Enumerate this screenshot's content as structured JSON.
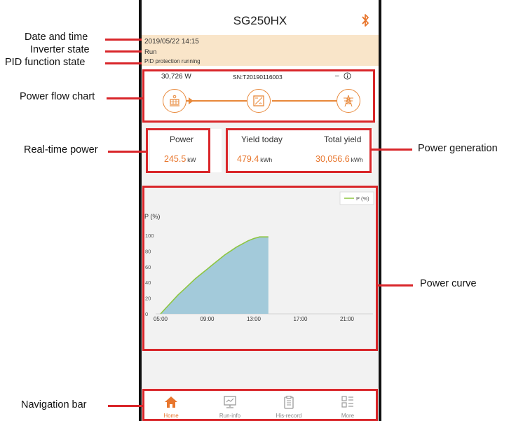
{
  "app": {
    "title": "SG250HX",
    "bluetooth_icon": "bluetooth-icon"
  },
  "status": {
    "datetime": "2019/05/22 14:15",
    "inverter_state": "Run",
    "pid_state": "PID protection running"
  },
  "flow": {
    "power": "30,726 W",
    "serial": "SN:T20190116003",
    "grid_value": "–",
    "nodes": [
      "pv-panel-icon",
      "inverter-icon",
      "grid-tower-icon"
    ],
    "accent": "#e8883a"
  },
  "realtime": {
    "title": "Power",
    "value": "245.5",
    "unit": "kW"
  },
  "generation": {
    "today_title": "Yield today",
    "today_value": "479.4",
    "today_unit": "kWh",
    "total_title": "Total yield",
    "total_value": "30,056.6",
    "total_unit": "kWh"
  },
  "chart_data": {
    "type": "area",
    "ylabel": "P (%)",
    "legend": [
      "P (%)"
    ],
    "legend_position": "top-right",
    "ylim": [
      0,
      100
    ],
    "yticks": [
      "0",
      "20",
      "40",
      "60",
      "80",
      "100"
    ],
    "xticks": [
      "05:00",
      "09:00",
      "13:00",
      "17:00",
      "21:00"
    ],
    "series": [
      {
        "name": "P (%)",
        "x": [
          "05:00",
          "05:30",
          "06:00",
          "06:30",
          "07:00",
          "07:30",
          "08:00",
          "08:30",
          "09:00",
          "09:30",
          "10:00",
          "10:30",
          "11:00",
          "11:30",
          "12:00",
          "12:30",
          "13:00",
          "13:30",
          "14:00",
          "14:15"
        ],
        "values": [
          0,
          8,
          16,
          24,
          31,
          38,
          45,
          51,
          57,
          63,
          69,
          75,
          80,
          85,
          89,
          93,
          96,
          98,
          98,
          98
        ]
      }
    ],
    "line_color": "#8ec641",
    "fill_color": "#9ec7d8"
  },
  "nav": {
    "items": [
      {
        "label": "Home",
        "icon": "home-icon",
        "active": true
      },
      {
        "label": "Run-info",
        "icon": "run-info-icon",
        "active": false
      },
      {
        "label": "His-record",
        "icon": "his-record-icon",
        "active": false
      },
      {
        "label": "More",
        "icon": "more-icon",
        "active": false
      }
    ]
  },
  "annotations": {
    "date_time": "Date and time",
    "inverter_state": "Inverter state",
    "pid_state": "PID function state",
    "power_flow_chart": "Power flow chart",
    "real_time_power": "Real-time power",
    "power_generation": "Power generation",
    "power_curve": "Power curve",
    "navigation_bar": "Navigation bar"
  },
  "colors": {
    "annotation": "#d9262a",
    "highlight": "#e8762d"
  }
}
